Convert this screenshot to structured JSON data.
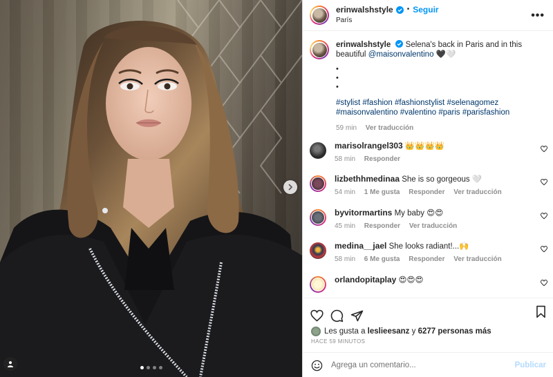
{
  "post": {
    "author": "erinwalshstyle",
    "follow_label": "Seguir",
    "separator": "•",
    "location": "París",
    "more_label": "•••",
    "carousel": {
      "slide_count": 4,
      "active_index": 0
    }
  },
  "caption": {
    "author": "erinwalshstyle",
    "text": "Selena's back in Paris and in this beautiful",
    "mention": "@maisonvalentino",
    "hearts": "🖤🤍",
    "dots": [
      "•",
      "•",
      "•"
    ],
    "hashtags_line1": "#stylist #fashion #fashionstylist #selenagomez",
    "hashtags_line2": "#maisonvalentino #valentino #paris #parisfashion",
    "time": "59 min",
    "translate": "Ver traducción"
  },
  "comments": [
    {
      "user": "marisolrangel303",
      "text": "👑👑👑👑",
      "time": "58 min",
      "likes": "",
      "reply": "Responder",
      "translate": "",
      "avatar_color": "#2a2a2a"
    },
    {
      "user": "lizbethhmedinaa",
      "text": "She is so gorgeous 🤍",
      "time": "54 min",
      "likes": "1 Me gusta",
      "reply": "Responder",
      "translate": "Ver traducción",
      "avatar_color": "#4b2a3a"
    },
    {
      "user": "byvitormartins",
      "text": "My baby 😍😍",
      "time": "45 min",
      "likes": "",
      "reply": "Responder",
      "translate": "Ver traducción",
      "avatar_color": "#3a3f4a"
    },
    {
      "user": "medina__jael",
      "text": "She looks radiant!...🙌",
      "time": "58 min",
      "likes": "6 Me gusta",
      "reply": "Responder",
      "translate": "Ver traducción",
      "avatar_color": "#2d3a52"
    },
    {
      "user": "orlandopitaplay",
      "text": "😍😍😍",
      "time": "",
      "likes": "",
      "reply": "",
      "translate": "",
      "avatar_color": "#e8d38a"
    }
  ],
  "likes": {
    "prefix": "Les gusta a",
    "first_user": "leslieesanz",
    "connector": "y",
    "others": "6277 personas más"
  },
  "time_ago": "HACE 59 MINUTOS",
  "comment_box": {
    "placeholder": "Agrega un comentario...",
    "publish_label": "Publicar"
  },
  "icons": {
    "verified": "verified-badge-icon",
    "like": "heart-icon",
    "comment": "comment-bubble-icon",
    "share": "paper-plane-icon",
    "save": "bookmark-icon",
    "emoji": "emoji-smile-icon",
    "next": "chevron-right-icon",
    "user_tag": "user-tag-icon"
  },
  "colors": {
    "link": "#00376b",
    "follow": "#0095f6",
    "verified": "#0095f6",
    "publish_disabled": "#b3dbff",
    "muted": "#8e8e8e"
  }
}
